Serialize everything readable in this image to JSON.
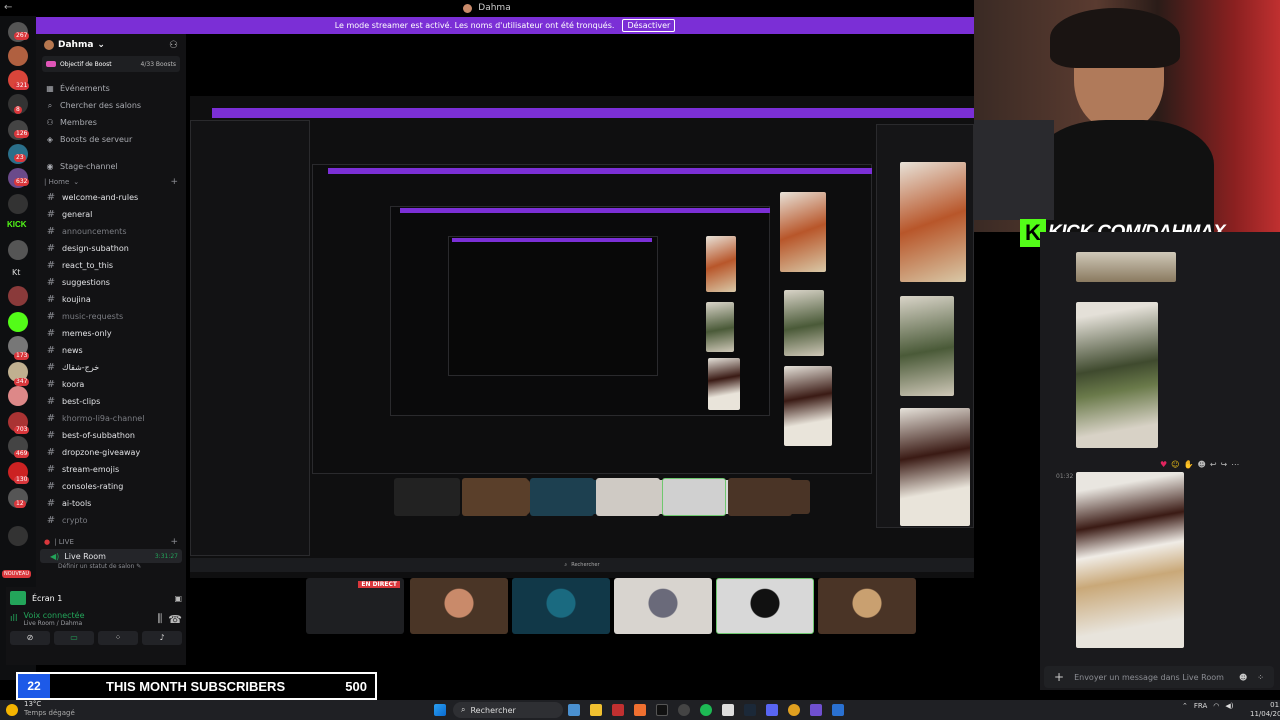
{
  "window": {
    "title": "Dahma",
    "banner_text": "Le mode streamer est activé. Les noms d'utilisateur ont été tronqués.",
    "banner_button": "Désactiver"
  },
  "server": {
    "name": "Dahma",
    "boost_label": "Objectif de Boost",
    "boost_count": "4/33 Boosts"
  },
  "menu": [
    {
      "label": "Événements",
      "icon": "calendar-icon"
    },
    {
      "label": "Chercher des salons",
      "icon": "search-icon"
    },
    {
      "label": "Membres",
      "icon": "members-icon"
    },
    {
      "label": "Boosts de serveur",
      "icon": "boost-icon"
    }
  ],
  "stage_channel": "Stage-channel",
  "category_home": "| Home",
  "channels": [
    {
      "label": "welcome-and-rules",
      "dim": false
    },
    {
      "label": "general",
      "dim": false
    },
    {
      "label": "announcements",
      "dim": true
    },
    {
      "label": "design-subathon",
      "dim": false
    },
    {
      "label": "react_to_this",
      "dim": false
    },
    {
      "label": "suggestions",
      "dim": false
    },
    {
      "label": "koujina",
      "dim": false
    },
    {
      "label": "music-requests",
      "dim": true
    },
    {
      "label": "memes-only",
      "dim": false
    },
    {
      "label": "news",
      "dim": false
    },
    {
      "label": "خرج-شقاك",
      "dim": false
    },
    {
      "label": "koora",
      "dim": false
    },
    {
      "label": "best-clips",
      "dim": false
    },
    {
      "label": "khormo-li9a-channel",
      "dim": true
    },
    {
      "label": "best-of-subbathon",
      "dim": false
    },
    {
      "label": "dropzone-giveaway",
      "dim": false
    },
    {
      "label": "stream-emojis",
      "dim": false
    },
    {
      "label": "consoles-rating",
      "dim": false
    },
    {
      "label": "ai-tools",
      "dim": false
    },
    {
      "label": "crypto",
      "dim": true
    }
  ],
  "category_live": "| LIVE",
  "live_room": {
    "label": "Live Room",
    "time": "3:31:27",
    "status": "Définir un statut de salon"
  },
  "voice": {
    "screen_label": "Écran 1",
    "connected": "Voix connectée",
    "location": "Live Room / Dahma"
  },
  "user_panel": {
    "name": "Dahma"
  },
  "subscribers": {
    "leader": "22",
    "title": "THIS MONTH SUBSCRIBERS",
    "value": "500"
  },
  "stream_tiles": {
    "live_badge": "EN DIRECT"
  },
  "kick": {
    "url": "KICK.COM/DAHMAX"
  },
  "chat": {
    "time": "01:32",
    "placeholder": "Envoyer un message dans  Live Room"
  },
  "taskbar": {
    "weather_temp": "13°C",
    "weather_desc": "Temps dégagé",
    "search": "Rechercher",
    "lang": "FRA",
    "time": "01:35",
    "date": "11/04/2026"
  },
  "rail_badges": [
    "267",
    "321",
    "8",
    "126",
    "23",
    "632",
    "173",
    "347",
    "703",
    "469",
    "130",
    "12"
  ],
  "nouveau": "NOUVEAU",
  "kick_rail": "KICK",
  "kt_rail": "Kt",
  "colors": {
    "banner": "#7b2fd6",
    "kick_green": "#53fc18",
    "live_green": "#23a55a",
    "badge_red": "#da373c",
    "subs_blue": "#1d5ae8"
  }
}
